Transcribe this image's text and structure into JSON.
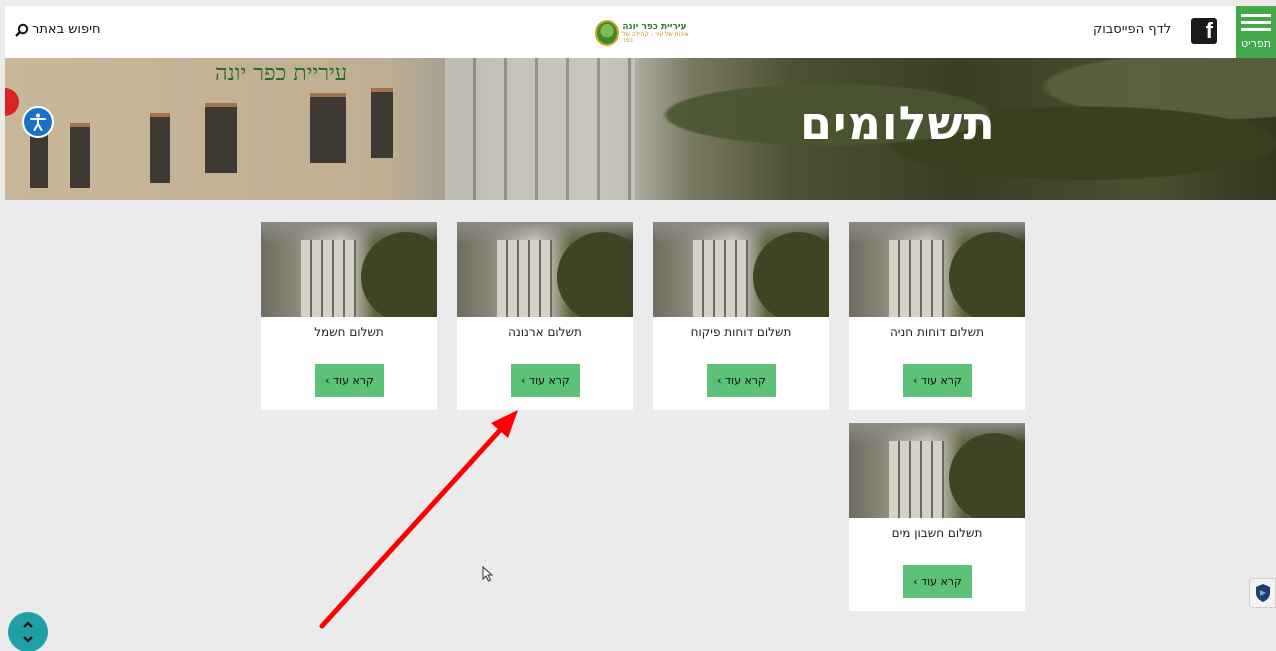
{
  "header": {
    "search_label": "חיפוש באתר",
    "logo_line1": "עיריית כפר יונה",
    "logo_line2": "איכות של עיר - קהילה של כפר",
    "facebook_label": "לדף הפייסבוק",
    "menu_label": "תפריט",
    "icons": {
      "search": "search-icon",
      "facebook": "facebook-icon",
      "menu": "hamburger-menu-icon"
    }
  },
  "hero": {
    "title": "תשלומים",
    "building_sign": "עיריית כפר יונה",
    "accessibility_icon": "accessibility-icon"
  },
  "cards": [
    {
      "title": "תשלום דוחות חניה",
      "button": "קרא עוד ›"
    },
    {
      "title": "תשלום דוחות פיקוח",
      "button": "קרא עוד ›"
    },
    {
      "title": "תשלום ארנונה",
      "button": "קרא עוד ›"
    },
    {
      "title": "תשלום חשמל",
      "button": "קרא עוד ›"
    },
    {
      "title": "תשלום חשבון מים",
      "button": "קרא עוד ›"
    }
  ],
  "colors": {
    "brand_green": "#42a84a",
    "button_green": "#5cc076",
    "background": "#ebebeb",
    "annotation_arrow": "#ff0000",
    "scroll_button": "#1fa0a6"
  },
  "floating": {
    "scroll_icon": "up-down-chevron-icon",
    "shield_icon": "shield-icon"
  }
}
